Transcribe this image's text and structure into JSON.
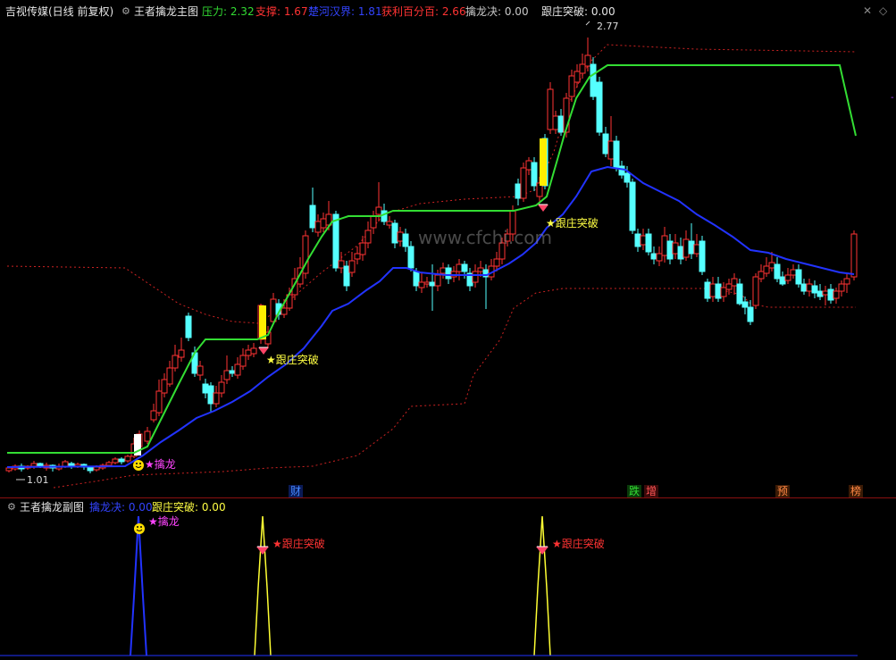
{
  "header": {
    "stock_title": "吉视传媒(日线 前复权)",
    "indicator_name": "王者擒龙主图",
    "items": [
      {
        "label": "压力: 2.32",
        "color": "#33dd33"
      },
      {
        "label": "支撑: 1.67",
        "color": "#ff3333"
      },
      {
        "label": "楚河汉界: 1.81",
        "color": "#3344ff"
      },
      {
        "label": "获利百分百: 2.66",
        "color": "#ff3333"
      },
      {
        "label": "擒龙决: 0.00",
        "color": "#c8c8c8"
      },
      {
        "label": "跟庄突破: 0.00",
        "color": "#e6e6e6"
      }
    ]
  },
  "main_chart": {
    "watermark": "www.cfchi.com",
    "high_label": "2.77",
    "low_label": "1.01",
    "signals": [
      {
        "label": "★擒龙",
        "color": "#ff44ff"
      },
      {
        "label": "★跟庄突破",
        "color": "#ffff44"
      },
      {
        "label": "★跟庄突破",
        "color": "#ffff44"
      }
    ],
    "bottom_tags": [
      {
        "label": "财",
        "color": "#4488ff"
      },
      {
        "label": "跌",
        "color": "#33dd33"
      },
      {
        "label": "增",
        "color": "#ff5555"
      },
      {
        "label": "预",
        "color": "#ff8844"
      },
      {
        "label": "榜",
        "color": "#ff8844"
      }
    ]
  },
  "sub_chart": {
    "indicator_name": "王者擒龙副图",
    "items": [
      {
        "label": "擒龙决: 0.00",
        "color": "#3344ff"
      },
      {
        "label": "跟庄突破: 0.00",
        "color": "#ffff44"
      }
    ],
    "signals": [
      {
        "label": "★擒龙",
        "color": "#ff44ff"
      },
      {
        "label": "★跟庄突破",
        "color": "#ff3333"
      },
      {
        "label": "★跟庄突破",
        "color": "#ff3333"
      }
    ]
  },
  "colors": {
    "up": "#ff3333",
    "down": "#55ffff",
    "pressure": "#33dd33",
    "boundary": "#2233ff",
    "band": "#cc2222",
    "highlight": "#ffee00"
  }
}
